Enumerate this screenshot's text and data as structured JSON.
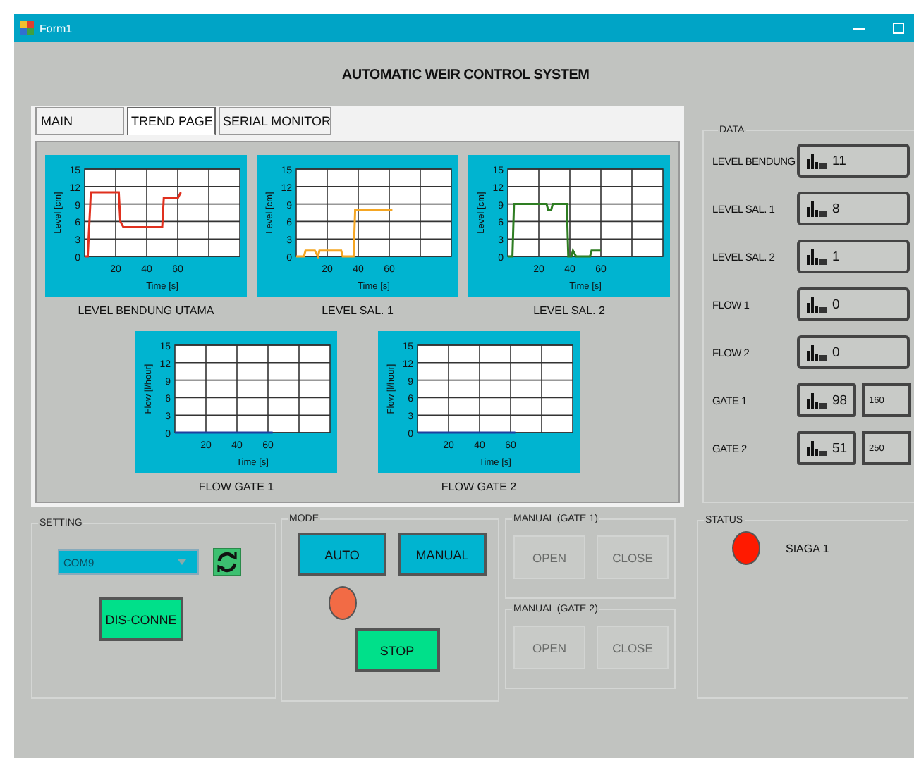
{
  "window": {
    "title": "Form1"
  },
  "heading": "AUTOMATIC WEIR CONTROL SYSTEM",
  "tabs": [
    {
      "label": "MAIN",
      "selected": false
    },
    {
      "label": "TREND PAGE",
      "selected": true
    },
    {
      "label": "SERIAL MONITOR",
      "selected": false
    }
  ],
  "trend_rows": [
    {
      "charts": [
        {
          "chart_data": {
            "type": "line",
            "title": "LEVEL BENDUNG UTAMA",
            "xlabel": "Time [s]",
            "ylabel": "Level [cm]",
            "x": [
              0,
              2,
              4,
              22,
              23,
              25,
              50,
              51,
              60,
              62
            ],
            "series": [
              {
                "color": "#e0301e",
                "values": [
                  0,
                  0,
                  11,
                  11,
                  6,
                  5,
                  5,
                  10,
                  10,
                  11
                ]
              }
            ],
            "grid": true,
            "xlim": [
              0,
              100
            ],
            "ylim": [
              0,
              15
            ],
            "xticks": [
              20,
              40,
              60
            ],
            "yticks": [
              0,
              3,
              6,
              9,
              12,
              15
            ]
          }
        },
        {
          "chart_data": {
            "type": "line",
            "title": "LEVEL SAL. 1",
            "xlabel": "Time [s]",
            "ylabel": "Level [cm]",
            "x": [
              0,
              5,
              6,
              12,
              14,
              15,
              29,
              30,
              37,
              38,
              62
            ],
            "series": [
              {
                "color": "#f5a623",
                "values": [
                  0,
                  0,
                  1,
                  1,
                  0,
                  1,
                  1,
                  0,
                  0,
                  8,
                  8
                ]
              }
            ],
            "grid": true,
            "xlim": [
              0,
              100
            ],
            "ylim": [
              0,
              15
            ],
            "xticks": [
              20,
              40,
              60
            ],
            "yticks": [
              0,
              3,
              6,
              9,
              12,
              15
            ]
          }
        },
        {
          "chart_data": {
            "type": "line",
            "title": "LEVEL SAL. 2",
            "xlabel": "Time [s]",
            "ylabel": "Level [cm]",
            "x": [
              0,
              3,
              4,
              25,
              26,
              28,
              29,
              38,
              39,
              41,
              42,
              44,
              51,
              53,
              54,
              56,
              60
            ],
            "series": [
              {
                "color": "#2e7d22",
                "values": [
                  0,
                  0,
                  9,
                  9,
                  8,
                  8,
                  9,
                  9,
                  0,
                  0,
                  1,
                  0,
                  0,
                  0,
                  1,
                  1,
                  1
                ]
              }
            ],
            "grid": true,
            "xlim": [
              0,
              100
            ],
            "ylim": [
              0,
              15
            ],
            "xticks": [
              20,
              40,
              60
            ],
            "yticks": [
              0,
              3,
              6,
              9,
              12,
              15
            ]
          }
        }
      ]
    },
    {
      "charts": [
        {
          "chart_data": {
            "type": "line",
            "title": "FLOW GATE 1",
            "xlabel": "Time [s]",
            "ylabel": "Flow [l/hour]",
            "x": [
              0,
              63
            ],
            "series": [
              {
                "color": "#1f3fa0",
                "values": [
                  0,
                  0
                ]
              }
            ],
            "grid": true,
            "xlim": [
              0,
              100
            ],
            "ylim": [
              0,
              15
            ],
            "xticks": [
              20,
              40,
              60
            ],
            "yticks": [
              0,
              3,
              6,
              9,
              12,
              15
            ]
          }
        },
        {
          "chart_data": {
            "type": "line",
            "title": "FLOW GATE 2",
            "xlabel": "Time [s]",
            "ylabel": "Flow [l/hour]",
            "x": [
              0,
              63
            ],
            "series": [
              {
                "color": "#1f3fa0",
                "values": [
                  0,
                  0
                ]
              }
            ],
            "grid": true,
            "xlim": [
              0,
              100
            ],
            "ylim": [
              0,
              15
            ],
            "xticks": [
              20,
              40,
              60
            ],
            "yticks": [
              0,
              3,
              6,
              9,
              12,
              15
            ]
          }
        }
      ]
    }
  ],
  "data": {
    "title": "DATA",
    "rows": [
      {
        "label": "LEVEL BENDUNG",
        "value": "11"
      },
      {
        "label": "LEVEL SAL. 1",
        "value": "8"
      },
      {
        "label": "LEVEL SAL. 2",
        "value": "1"
      },
      {
        "label": "FLOW 1",
        "value": "0"
      },
      {
        "label": "FLOW 2",
        "value": "0"
      },
      {
        "label": "GATE 1",
        "value": "98",
        "setpoint": "160"
      },
      {
        "label": "GATE 2",
        "value": "51",
        "setpoint": "250"
      }
    ]
  },
  "setting": {
    "title": "SETTING",
    "port": {
      "value": "COM9"
    },
    "connect_button": "DIS-CONNE"
  },
  "mode": {
    "title": "MODE",
    "buttons": [
      {
        "label": "AUTO"
      },
      {
        "label": "MANUAL"
      }
    ],
    "indicator": {
      "color": "#f26b45"
    },
    "stop_button": "STOP"
  },
  "manual": [
    {
      "title": "MANUAL (GATE 1)",
      "buttons": [
        {
          "label": "OPEN",
          "disabled": true
        },
        {
          "label": "CLOSE",
          "disabled": true
        }
      ]
    },
    {
      "title": "MANUAL (GATE 2)",
      "buttons": [
        {
          "label": "OPEN",
          "disabled": true
        },
        {
          "label": "CLOSE",
          "disabled": true
        }
      ]
    }
  ],
  "status": {
    "title": "STATUS",
    "indicator": {
      "color": "#ff1a00"
    },
    "text": "SIAGA 1"
  }
}
